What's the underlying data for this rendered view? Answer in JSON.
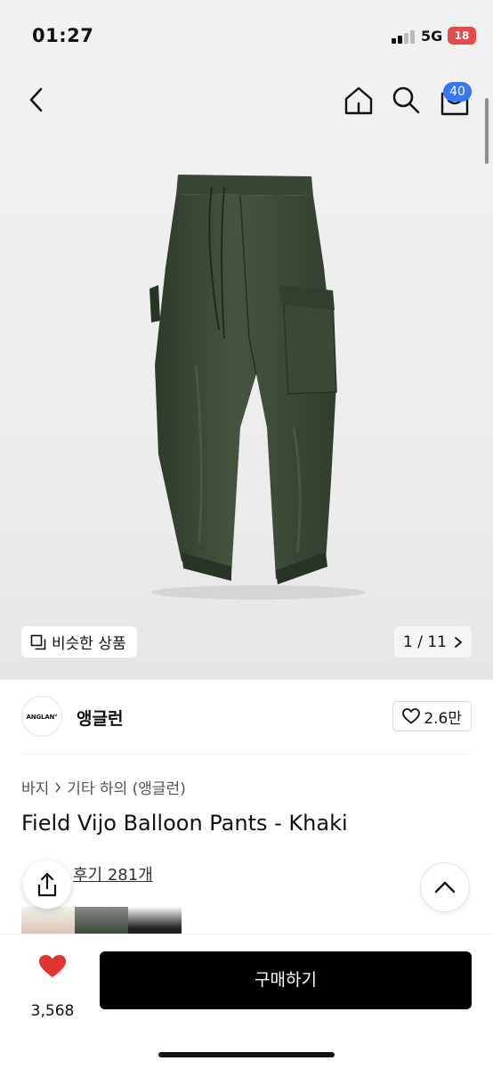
{
  "status_bar": {
    "time": "01:27",
    "network": "5G",
    "battery": "18"
  },
  "nav": {
    "cart_count": "40"
  },
  "gallery": {
    "similar_label": "비슷한 상품",
    "pager": "1 / 11",
    "product_color": "#3d4a37"
  },
  "brand": {
    "logo_text": "ANGLAN°",
    "name": "앵글런",
    "likes": "2.6만"
  },
  "breadcrumb": [
    "바지",
    "기타 하의 (앵글런)"
  ],
  "product": {
    "title": "Field Vijo Balloon Pants - Khaki"
  },
  "reviews": {
    "label": "후기 281개"
  },
  "bottom": {
    "like_count": "3,568",
    "buy_label": "구매하기"
  },
  "colors": {
    "accent_blue": "#3478f6",
    "like_red": "#e3342f",
    "buy_black": "#000000"
  }
}
